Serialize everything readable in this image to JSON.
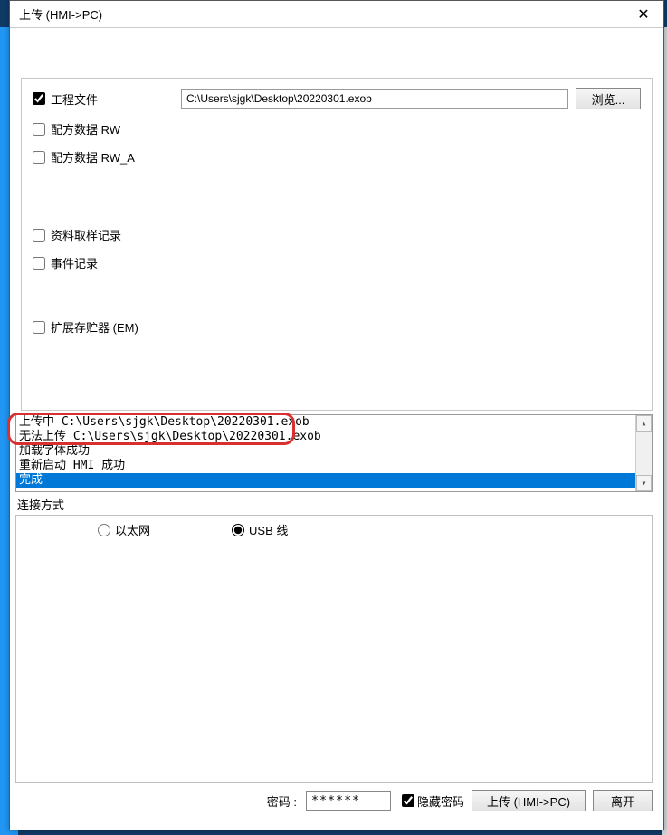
{
  "window": {
    "title": "上传 (HMI->PC)"
  },
  "options": {
    "project": {
      "label": "工程文件",
      "checked": true
    },
    "recipe_rw": {
      "label": "配方数据 RW",
      "checked": false
    },
    "recipe_rw_a": {
      "label": "配方数据 RW_A",
      "checked": false
    },
    "sampling": {
      "label": "资料取样记录",
      "checked": false
    },
    "event": {
      "label": "事件记录",
      "checked": false
    },
    "em": {
      "label": "扩展存贮器 (EM)",
      "checked": false
    }
  },
  "path": {
    "value": "C:\\Users\\sjgk\\Desktop\\20220301.exob",
    "browse_label": "浏览..."
  },
  "log": {
    "lines": [
      "上传中 C:\\Users\\sjgk\\Desktop\\20220301.exob",
      "无法上传 C:\\Users\\sjgk\\Desktop\\20220301.exob",
      "加载字体成功",
      "重新启动 HMI 成功",
      "完成"
    ],
    "selected_index": 4
  },
  "connection": {
    "label": "连接方式",
    "ethernet": {
      "label": "以太网",
      "checked": false
    },
    "usb": {
      "label": "USB 线",
      "checked": true
    }
  },
  "bottom": {
    "password_label": "密码 :",
    "password_value": "******",
    "hide_pw_label": "隐藏密码",
    "hide_pw_checked": true,
    "upload_label": "上传 (HMI->PC)",
    "leave_label": "离开"
  }
}
